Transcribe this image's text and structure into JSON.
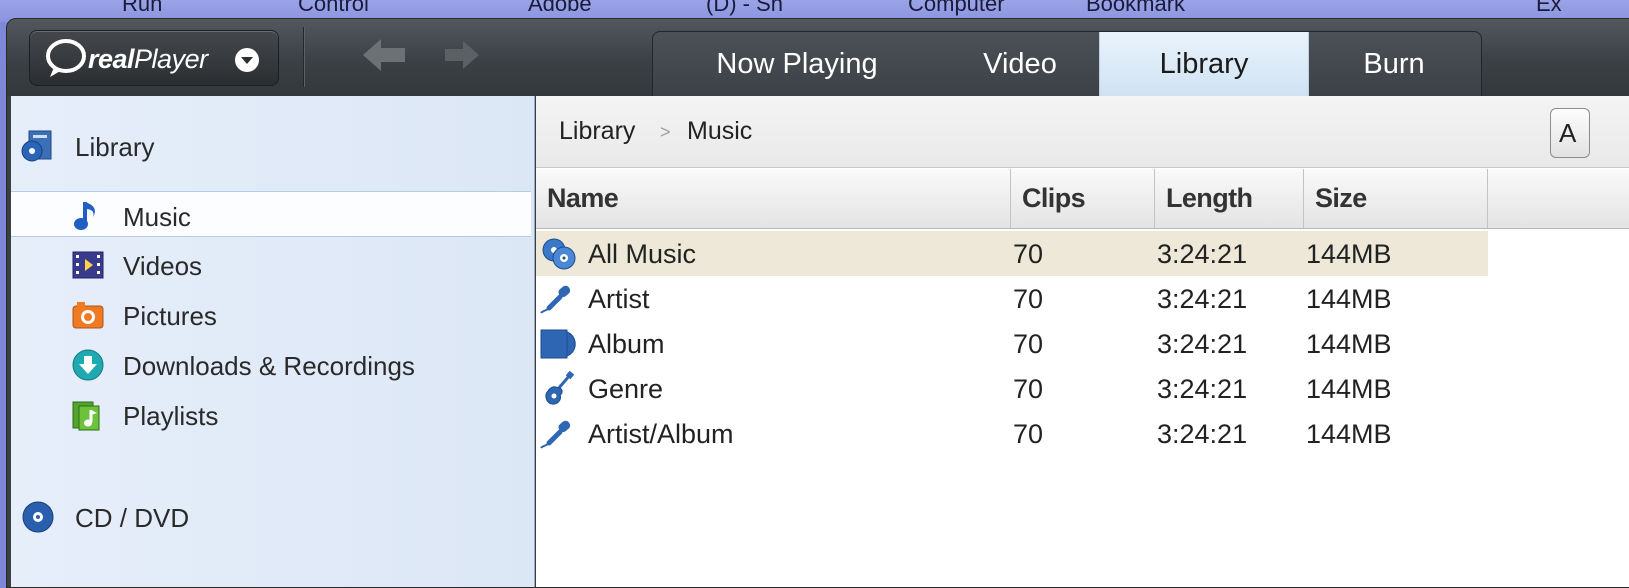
{
  "desktop": {
    "labels": [
      "Run",
      "Control",
      "Adobe",
      "(D) - Sh",
      "Computer",
      "Bookmark",
      "Ex"
    ]
  },
  "toolbar": {
    "logo_text_bold": "real",
    "logo_text_thin": "Player",
    "tabs": [
      {
        "label": "Now Playing",
        "active": false
      },
      {
        "label": "Video",
        "active": false
      },
      {
        "label": "Library",
        "active": true
      },
      {
        "label": "Burn",
        "active": false
      }
    ]
  },
  "sidebar": {
    "items": [
      {
        "label": "Library",
        "icon": "library-icon"
      },
      {
        "label": "Music",
        "icon": "music-note-icon",
        "selected": true
      },
      {
        "label": "Videos",
        "icon": "film-icon"
      },
      {
        "label": "Pictures",
        "icon": "camera-icon"
      },
      {
        "label": "Downloads & Recordings",
        "icon": "download-icon"
      },
      {
        "label": "Playlists",
        "icon": "playlist-icon"
      },
      {
        "label": "CD / DVD",
        "icon": "disc-icon"
      }
    ]
  },
  "main": {
    "breadcrumb": [
      "Library",
      "Music"
    ],
    "breadcrumb_separator": ">",
    "edge_button_label": "A",
    "columns": [
      "Name",
      "Clips",
      "Length",
      "Size"
    ],
    "rows": [
      {
        "name": "All Music",
        "clips": "70",
        "length": "3:24:21",
        "size": "144MB",
        "icon": "all-music-icon",
        "selected": true
      },
      {
        "name": "Artist",
        "clips": "70",
        "length": "3:24:21",
        "size": "144MB",
        "icon": "microphone-icon"
      },
      {
        "name": "Album",
        "clips": "70",
        "length": "3:24:21",
        "size": "144MB",
        "icon": "album-icon"
      },
      {
        "name": "Genre",
        "clips": "70",
        "length": "3:24:21",
        "size": "144MB",
        "icon": "guitar-icon"
      },
      {
        "name": "Artist/Album",
        "clips": "70",
        "length": "3:24:21",
        "size": "144MB",
        "icon": "microphone-icon"
      }
    ]
  },
  "colors": {
    "toolbar_bg": "#3b4045",
    "active_tab": "#d8e8f6",
    "sidebar_bg": "#e2ebf8",
    "selected_row": "#ede8d8",
    "icon_blue": "#2a64b8"
  }
}
